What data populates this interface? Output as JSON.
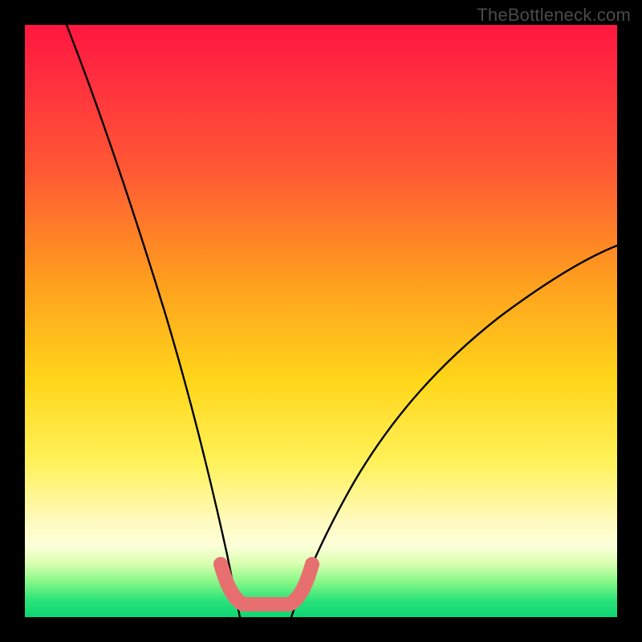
{
  "watermark": "TheBottleneck.com",
  "chart_data": {
    "type": "line",
    "title": "",
    "xlabel": "",
    "ylabel": "",
    "xlim": [
      0,
      100
    ],
    "ylim": [
      0,
      100
    ],
    "grid": false,
    "legend": false,
    "series": [
      {
        "name": "left-curve",
        "x": [
          7,
          10,
          13,
          16,
          19,
          22,
          25,
          28,
          31,
          33,
          34.5,
          36
        ],
        "values": [
          100,
          91,
          82,
          72,
          62,
          51,
          40,
          29,
          18,
          9,
          4,
          0
        ]
      },
      {
        "name": "right-curve",
        "x": [
          45,
          48,
          52,
          57,
          63,
          70,
          78,
          87,
          96,
          100
        ],
        "values": [
          0,
          4,
          10,
          17,
          25,
          33,
          41,
          49,
          56,
          59
        ]
      },
      {
        "name": "bottom-highlight",
        "x": [
          33,
          34,
          35,
          36,
          37,
          38,
          40,
          42,
          44,
          45,
          46,
          47,
          48
        ],
        "values": [
          9,
          5,
          3,
          2,
          2,
          2,
          2,
          2,
          2,
          2,
          3,
          5,
          9
        ],
        "style": "thick-salmon"
      }
    ],
    "background_gradient": {
      "top": "#ff163f",
      "mid": "#ffd61a",
      "bottom": "#0cd573"
    }
  }
}
